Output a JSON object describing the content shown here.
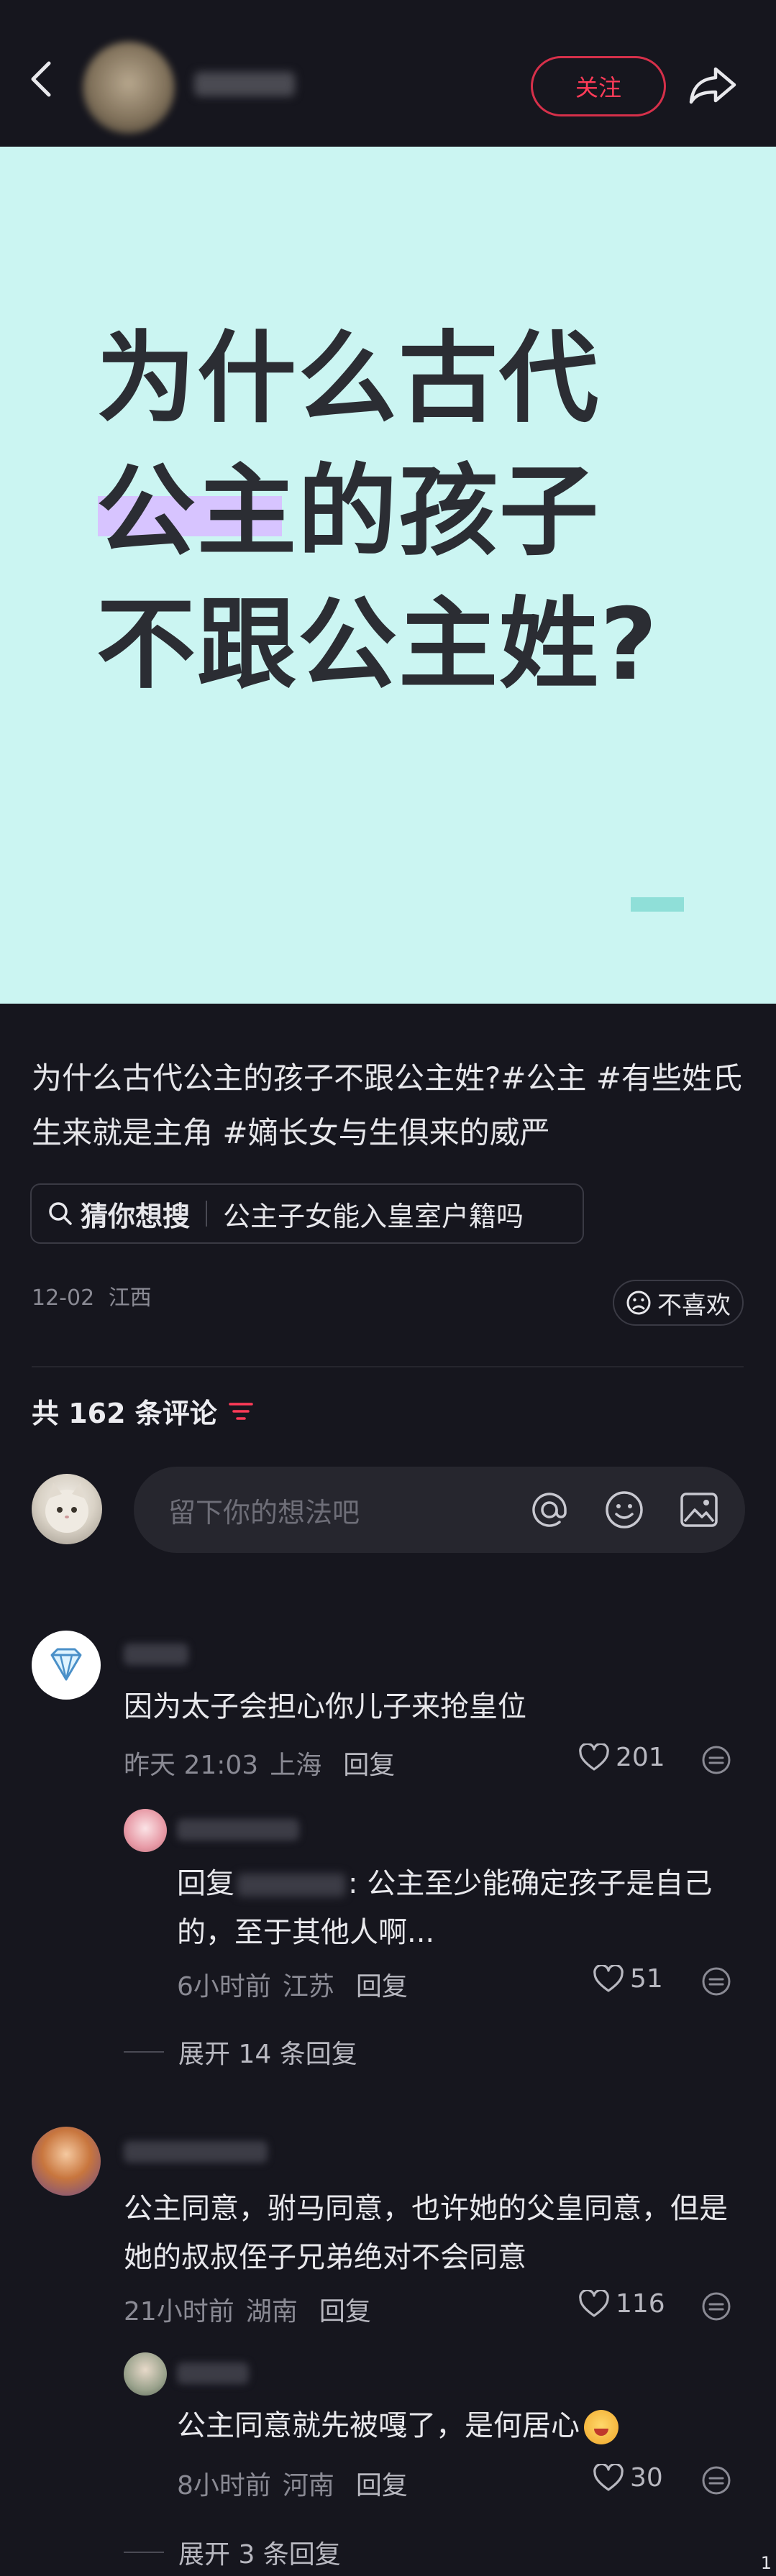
{
  "header": {
    "follow_label": "关注"
  },
  "cover": {
    "line1": "为什么古代",
    "line2": "公主的孩子",
    "line3": "不跟公主姓?"
  },
  "post": {
    "desc_main": "为什么古代公主的孩子不跟公主姓?",
    "tags": [
      "#公主",
      "#有些姓氏生来就是主角",
      "#嫡长女与生俱来的威严"
    ],
    "search_label": "猜你想搜",
    "search_query": "公主子女能入皇室户籍吗",
    "date": "12-02",
    "location": "江西",
    "dislike_label": "不喜欢"
  },
  "comments_header": {
    "count_text": "共 162 条评论",
    "input_placeholder": "留下你的想法吧"
  },
  "comments": [
    {
      "text": "因为太子会担心你儿子来抢皇位",
      "time": "昨天 21:03",
      "region": "上海",
      "reply_label": "回复",
      "likes": "201",
      "sub": {
        "prefix": "回复",
        "text": ": 公主至少能确定孩子是自己的，至于其他人啊...",
        "time": "6小时前",
        "region": "江苏",
        "reply_label": "回复",
        "likes": "51"
      },
      "expand": "展开 14 条回复"
    },
    {
      "text": "公主同意，驸马同意，也许她的父皇同意，但是她的叔叔侄子兄弟绝对不会同意",
      "time": "21小时前",
      "region": "湖南",
      "reply_label": "回复",
      "likes": "116",
      "sub": {
        "text": "公主同意就先被嘎了，是何居心",
        "time": "8小时前",
        "region": "河南",
        "reply_label": "回复",
        "likes": "30"
      },
      "expand": "展开 3 条回复"
    }
  ],
  "corner_number": "1"
}
